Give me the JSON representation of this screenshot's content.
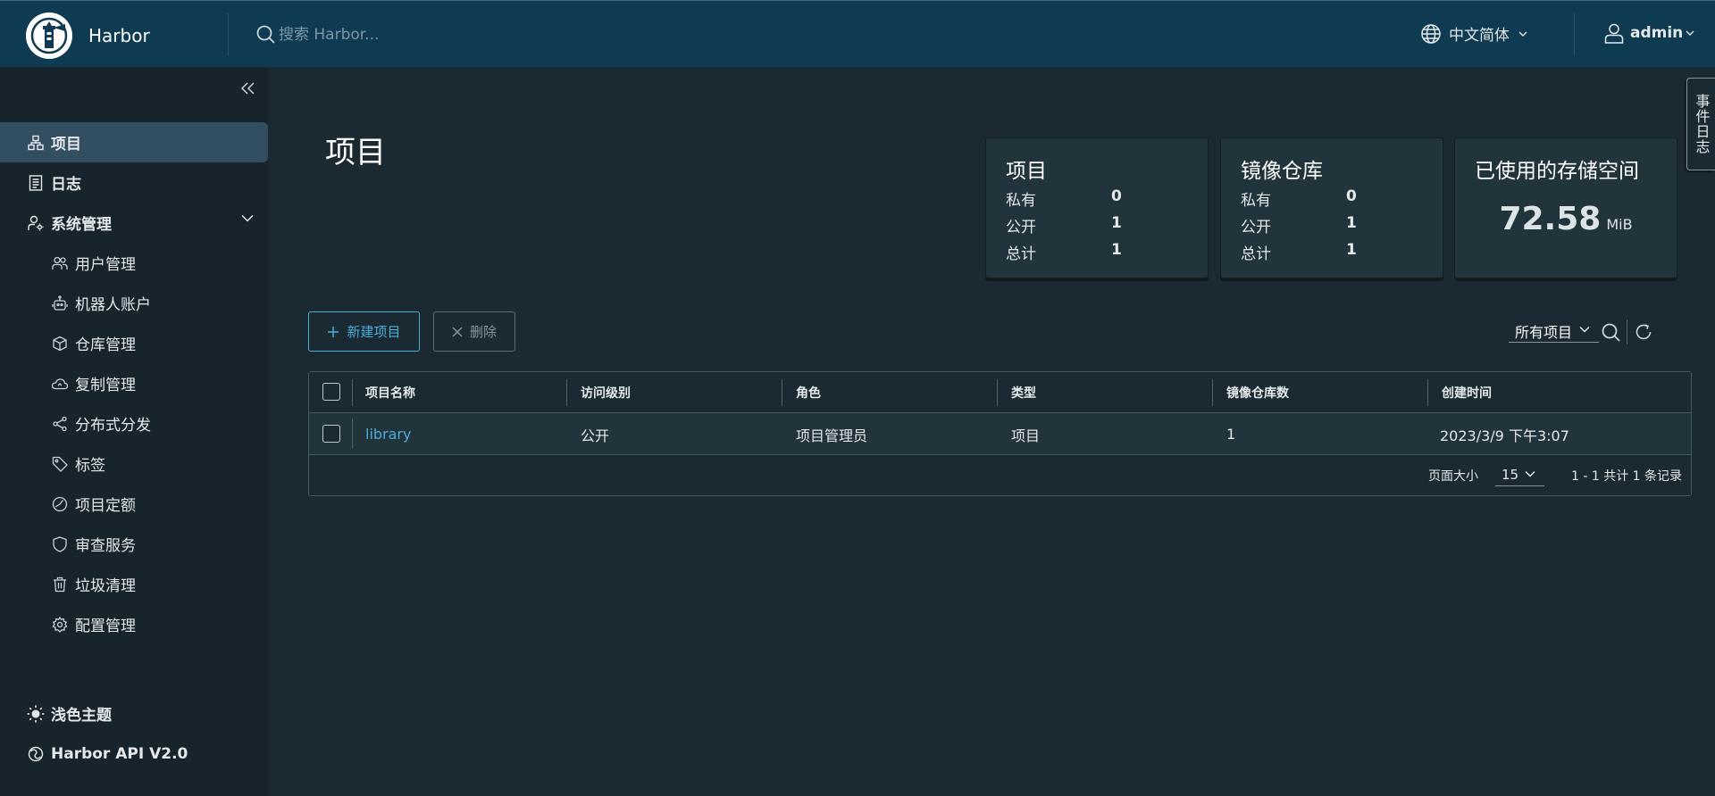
{
  "header": {
    "brand": "Harbor",
    "search_placeholder": "搜索 Harbor...",
    "language": "中文简体",
    "user": "admin"
  },
  "sidebar": {
    "items": [
      {
        "label": "项目",
        "icon": "projects-icon",
        "active": true
      },
      {
        "label": "日志",
        "icon": "logs-icon"
      },
      {
        "label": "系统管理",
        "icon": "admin-icon"
      }
    ],
    "subitems": [
      {
        "label": "用户管理",
        "icon": "users-icon"
      },
      {
        "label": "机器人账户",
        "icon": "robot-icon"
      },
      {
        "label": "仓库管理",
        "icon": "registry-icon"
      },
      {
        "label": "复制管理",
        "icon": "replication-icon"
      },
      {
        "label": "分布式分发",
        "icon": "share-icon"
      },
      {
        "label": "标签",
        "icon": "tag-icon"
      },
      {
        "label": "项目定额",
        "icon": "quota-icon"
      },
      {
        "label": "审查服务",
        "icon": "shield-icon"
      },
      {
        "label": "垃圾清理",
        "icon": "trash-icon"
      },
      {
        "label": "配置管理",
        "icon": "gear-icon"
      }
    ],
    "bottom": [
      {
        "label": "浅色主题",
        "icon": "sun-icon"
      },
      {
        "label": "Harbor API V2.0",
        "icon": "api-icon"
      }
    ]
  },
  "main": {
    "title": "项目",
    "cards": {
      "projects": {
        "title": "项目",
        "rows": [
          {
            "label": "私有",
            "value": "0"
          },
          {
            "label": "公开",
            "value": "1"
          },
          {
            "label": "总计",
            "value": "1"
          }
        ]
      },
      "repositories": {
        "title": "镜像仓库",
        "rows": [
          {
            "label": "私有",
            "value": "0"
          },
          {
            "label": "公开",
            "value": "1"
          },
          {
            "label": "总计",
            "value": "1"
          }
        ]
      },
      "storage": {
        "title": "已使用的存储空间",
        "value": "72.58",
        "unit": "MiB"
      }
    },
    "new_project": "新建项目",
    "delete": "删除",
    "filter": "所有项目",
    "table": {
      "columns": [
        "项目名称",
        "访问级别",
        "角色",
        "类型",
        "镜像仓库数",
        "创建时间"
      ],
      "rows": [
        [
          "library",
          "公开",
          "项目管理员",
          "项目",
          "1",
          "2023/3/9 下午3:07"
        ]
      ]
    },
    "footer": {
      "page_size_label": "页面大小",
      "page_size": "15",
      "info": "1 - 1 共计 1 条记录"
    }
  },
  "event_tab": "事件日志"
}
